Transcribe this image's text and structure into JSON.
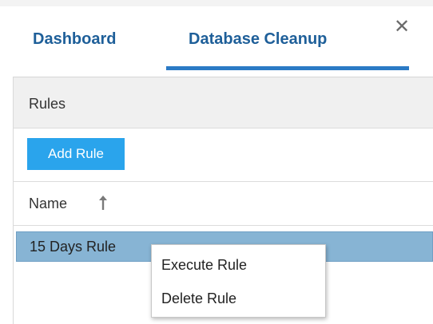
{
  "tabs": [
    {
      "label": "Dashboard",
      "active": false
    },
    {
      "label": "Database Cleanup",
      "active": true
    }
  ],
  "tab_close_label": "✕",
  "panel": {
    "title": "Rules",
    "add_button_label": "Add Rule"
  },
  "grid": {
    "columns": [
      {
        "label": "Name",
        "sort": "ascending",
        "sort_icon": "arrow-up-icon"
      }
    ],
    "rows": [
      {
        "name": "15 Days Rule",
        "selected": true
      }
    ]
  },
  "context_menu": {
    "items": [
      {
        "label": "Execute Rule"
      },
      {
        "label": "Delete Rule"
      }
    ]
  },
  "colors": {
    "tab_text": "#1e5f99",
    "tab_underline": "#2b7ac5",
    "add_button": "#2aa4ec",
    "selected_row": "#87b4d4",
    "panel_header": "#f0f0f0"
  }
}
